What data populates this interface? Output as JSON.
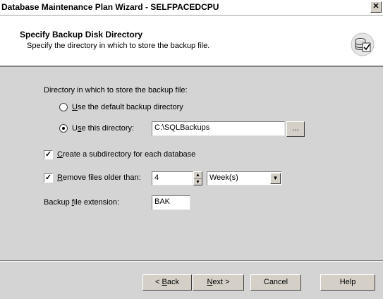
{
  "window": {
    "title": "Database Maintenance Plan Wizard - SELFPACEDCPU",
    "close_glyph": "✕"
  },
  "header": {
    "title": "Specify Backup Disk Directory",
    "subtitle": "Specify the directory in which to store the backup file.",
    "icon": "database-backup-icon"
  },
  "form": {
    "directory_group_label": "Directory in which to store the backup file:",
    "radio_default": {
      "prefix": "",
      "mnemonic": "U",
      "rest": "se the default backup directory",
      "checked": false
    },
    "radio_this": {
      "prefix": "U",
      "mnemonic": "s",
      "rest": "e this directory:",
      "checked": true
    },
    "directory_value": "C:\\SQLBackups",
    "browse_label": "...",
    "create_subdir": {
      "prefix": "",
      "mnemonic": "C",
      "rest": "reate a subdirectory for each database",
      "checked": true
    },
    "remove_files": {
      "prefix": "",
      "mnemonic": "R",
      "rest": "emove files older than:",
      "checked": true
    },
    "remove_value": "4",
    "remove_unit": "Week(s)",
    "extension_label": {
      "prefix": "Backup ",
      "mnemonic": "f",
      "rest": "ile extension:"
    },
    "extension_value": "BAK"
  },
  "footer": {
    "back": {
      "prefix": "< ",
      "mnemonic": "B",
      "rest": "ack"
    },
    "next": {
      "prefix": "",
      "mnemonic": "N",
      "rest": "ext >"
    },
    "cancel": "Cancel",
    "help": "Help"
  }
}
